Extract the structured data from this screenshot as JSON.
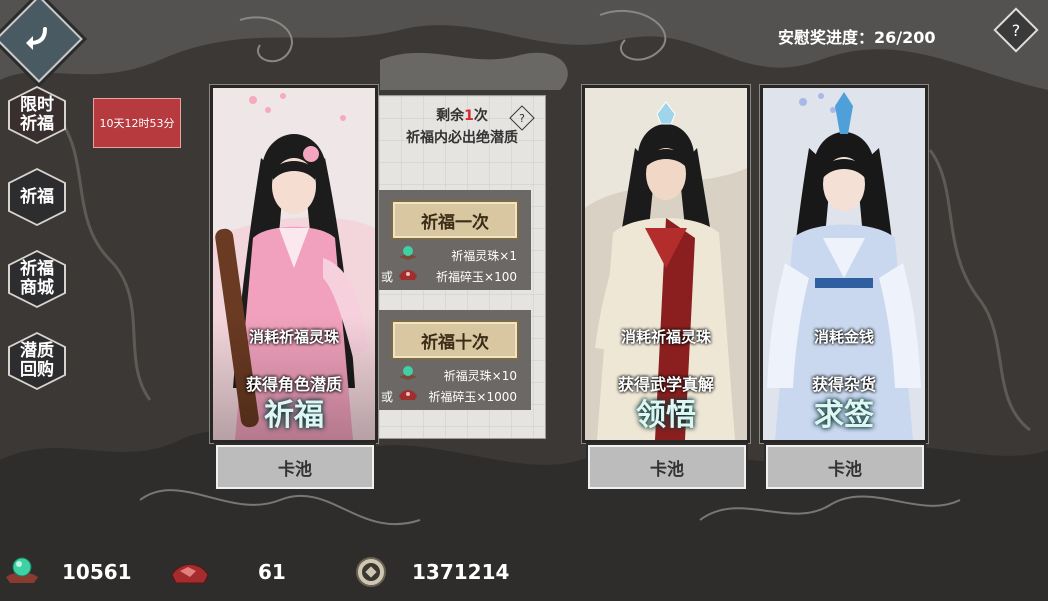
{
  "header": {
    "progress_label": "安慰奖进度：26/200",
    "help_symbol": "?"
  },
  "sidebar": {
    "items": [
      {
        "label": "限时祈福",
        "active": true
      },
      {
        "label": "祈福",
        "active": false
      },
      {
        "label": "祈福商城",
        "active": false
      },
      {
        "label": "潜质回购",
        "active": false
      }
    ],
    "timer": "10天12时53分"
  },
  "cards": [
    {
      "line1": "消耗祈福灵珠",
      "line2": "获得角色潜质",
      "name": "祈福",
      "pool_button": "卡池"
    },
    {
      "line1": "消耗祈福灵珠",
      "line2": "获得武学真解",
      "name": "领悟",
      "pool_button": "卡池"
    },
    {
      "line1": "消耗金钱",
      "line2": "获得杂货",
      "name": "求签",
      "pool_button": "卡池"
    }
  ],
  "draw_panel": {
    "remain_prefix": "剩余",
    "remain_count": "1",
    "remain_suffix": "次",
    "guarantee": "祈福内必出绝潜质",
    "info_symbol": "?",
    "single": {
      "button": "祈福一次",
      "cost_pearl": "祈福灵珠×1",
      "or": "或",
      "cost_jade": "祈福碎玉×100"
    },
    "ten": {
      "button": "祈福十次",
      "cost_pearl": "祈福灵珠×10",
      "or": "或",
      "cost_jade": "祈福碎玉×1000"
    }
  },
  "currency": {
    "pearl": "10561",
    "jade": "61",
    "coin": "1371214"
  },
  "colors": {
    "accent_red": "#d42c2c",
    "timer_bg": "#b73a3e",
    "button_gold": "#d9c7a1"
  },
  "icons": [
    "back-arrow-icon",
    "help-icon",
    "pearl-icon",
    "jade-icon",
    "coin-icon"
  ]
}
